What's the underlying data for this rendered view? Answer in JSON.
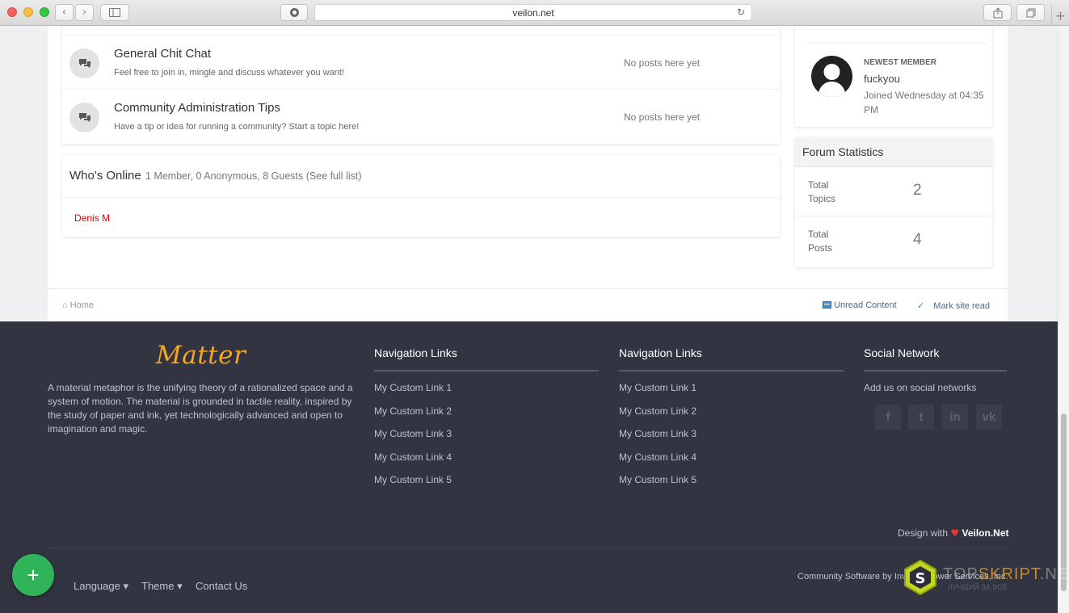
{
  "browser": {
    "url": "veilon.net",
    "back_glyph": "‹",
    "forward_glyph": "›",
    "new_tab_glyph": "+"
  },
  "forums": [
    {
      "title": "General Chit Chat",
      "description": "Feel free to join in, mingle and discuss whatever you want!",
      "status": "No posts here yet"
    },
    {
      "title": "Community Administration Tips",
      "description": "Have a tip or idea for running a community? Start a topic here!",
      "status": "No posts here yet"
    }
  ],
  "online": {
    "title": "Who's Online",
    "summary": "1 Member, 0 Anonymous, 8 Guests (See full list)",
    "members": [
      "Denis M"
    ]
  },
  "newest_member": {
    "label": "NEWEST MEMBER",
    "name": "fuckyou",
    "joined": "Joined Wednesday at 04:35 PM"
  },
  "stats": {
    "title": "Forum Statistics",
    "rows": [
      {
        "label": "Total Topics",
        "value": "2"
      },
      {
        "label": "Total Posts",
        "value": "4"
      }
    ]
  },
  "breadcrumb": {
    "home": "Home",
    "unread": "Unread Content",
    "mark_read": "Mark site read"
  },
  "footer": {
    "logo": "Matter",
    "about": "A material metaphor is the unifying theory of a rationalized space and a system of motion. The material is grounded in tactile reality, inspired by the study of paper and ink, yet technologically advanced and open to imagination and magic.",
    "columns": [
      {
        "title": "Navigation Links",
        "links": [
          "My Custom Link 1",
          "My Custom Link 2",
          "My Custom Link 3",
          "My Custom Link 4",
          "My Custom Link 5"
        ]
      },
      {
        "title": "Navigation Links",
        "links": [
          "My Custom Link 1",
          "My Custom Link 2",
          "My Custom Link 3",
          "My Custom Link 4",
          "My Custom Link 5"
        ]
      }
    ],
    "social": {
      "title": "Social Network",
      "subtitle": "Add us on social networks",
      "icons": [
        {
          "name": "facebook-icon",
          "glyph": "f"
        },
        {
          "name": "twitter-icon",
          "glyph": "t"
        },
        {
          "name": "linkedin-icon",
          "glyph": "in"
        },
        {
          "name": "vk-icon",
          "glyph": "vk"
        }
      ]
    },
    "design_prefix": "Design with",
    "design_brand": "Veilon.Net",
    "nav": [
      "Language ▾",
      "Theme ▾",
      "Contact Us"
    ],
    "community": "Community Software by Invision Power Services, Inc.",
    "fab_glyph": "+"
  },
  "watermark": {
    "text_a": "TOP",
    "text_b": "SKRIPT",
    "text_c": ".NET",
    "sub": "ЛУЧШИЙ ЗА ВСЁ"
  },
  "colors": {
    "accent": "#f5a623",
    "footer_bg": "#323541",
    "fab": "#2fb45a",
    "online_user": "#e60000"
  }
}
